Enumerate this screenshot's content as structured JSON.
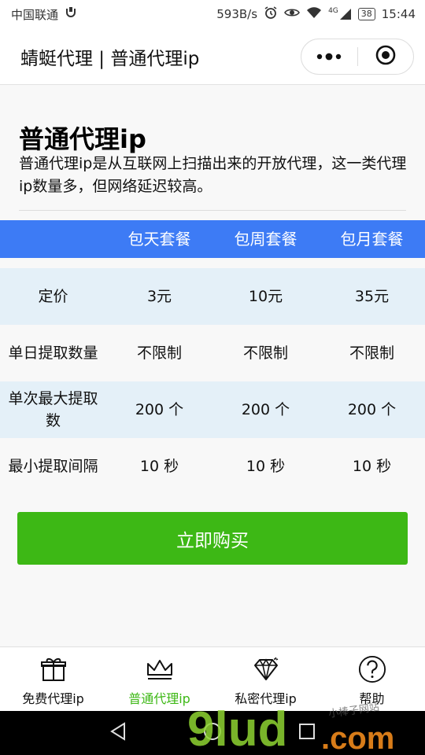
{
  "status_bar": {
    "carrier": "中国联通",
    "net_speed": "593B/s",
    "network": "4G",
    "battery": "38",
    "time": "15:44"
  },
  "nav": {
    "title": "蜻蜓代理 | 普通代理ip",
    "more_icon": "more-dots-icon",
    "close_icon": "target-circle-icon"
  },
  "header": {
    "title": "普通代理ip",
    "description": "普通代理ip是从互联网上扫描出来的开放代理，这一类代理ip数量多，但网络延迟较高。"
  },
  "pricing": {
    "columns": [
      "",
      "包天套餐",
      "包周套餐",
      "包月套餐"
    ],
    "rows": [
      {
        "label": "定价",
        "values": [
          "3元",
          "10元",
          "35元"
        ]
      },
      {
        "label": "单日提取数量",
        "values": [
          "不限制",
          "不限制",
          "不限制"
        ]
      },
      {
        "label": "单次最大提取数",
        "values": [
          "200 个",
          "200 个",
          "200 个"
        ]
      },
      {
        "label": "最小提取间隔",
        "values": [
          "10 秒",
          "10 秒",
          "10 秒"
        ]
      }
    ]
  },
  "buy_button": "立即购买",
  "tabs": [
    {
      "label": "免费代理ip",
      "icon": "gift-icon",
      "active": false
    },
    {
      "label": "普通代理ip",
      "icon": "crown-icon",
      "active": true
    },
    {
      "label": "私密代理ip",
      "icon": "diamond-icon",
      "active": false
    },
    {
      "label": "帮助",
      "icon": "help-icon",
      "active": false
    }
  ],
  "colors": {
    "accent_blue": "#3d7bf5",
    "accent_green": "#3db815",
    "row_alt": "#e4f0f8"
  },
  "watermark": {
    "logo_text": "9lud.com",
    "tagline": "小棒子网站"
  }
}
